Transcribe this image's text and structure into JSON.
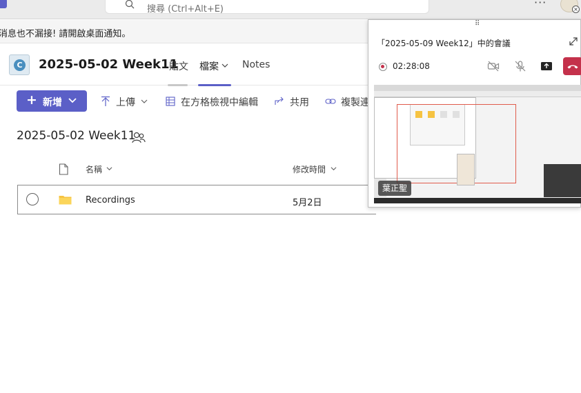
{
  "titlebar": {
    "search_placeholder": "搜尋 (Ctrl+Alt+E)",
    "more_label": "···"
  },
  "banner": {
    "text": "消息也不漏接! 請開啟桌面通知。"
  },
  "channel": {
    "title": "2025-05-02 Week11",
    "avatar_letter": "C",
    "tabs": [
      {
        "label": "貼文",
        "selected": false
      },
      {
        "label": "檔案",
        "selected": true
      },
      {
        "label": "Notes",
        "selected": false
      }
    ]
  },
  "toolbar": {
    "new_label": "新增",
    "upload_label": "上傳",
    "grid_edit_label": "在方格檢視中編輯",
    "share_label": "共用",
    "copy_link_label": "複製連"
  },
  "folder": {
    "title": "2025-05-02 Week11"
  },
  "file_list": {
    "columns": {
      "name": "名稱",
      "modified": "修改時間"
    },
    "rows": [
      {
        "name": "Recordings",
        "modified": "5月2日"
      }
    ]
  },
  "meeting": {
    "title": "「2025-05-09 Week12」中的會議",
    "elapsed": "02:28:08",
    "speaker": "葉正聖",
    "drag_glyph": "⠿"
  },
  "colors": {
    "accent": "#5b5fc7",
    "hangup": "#c4314b",
    "folder": "#f6c342",
    "recording": "#c4314b"
  }
}
